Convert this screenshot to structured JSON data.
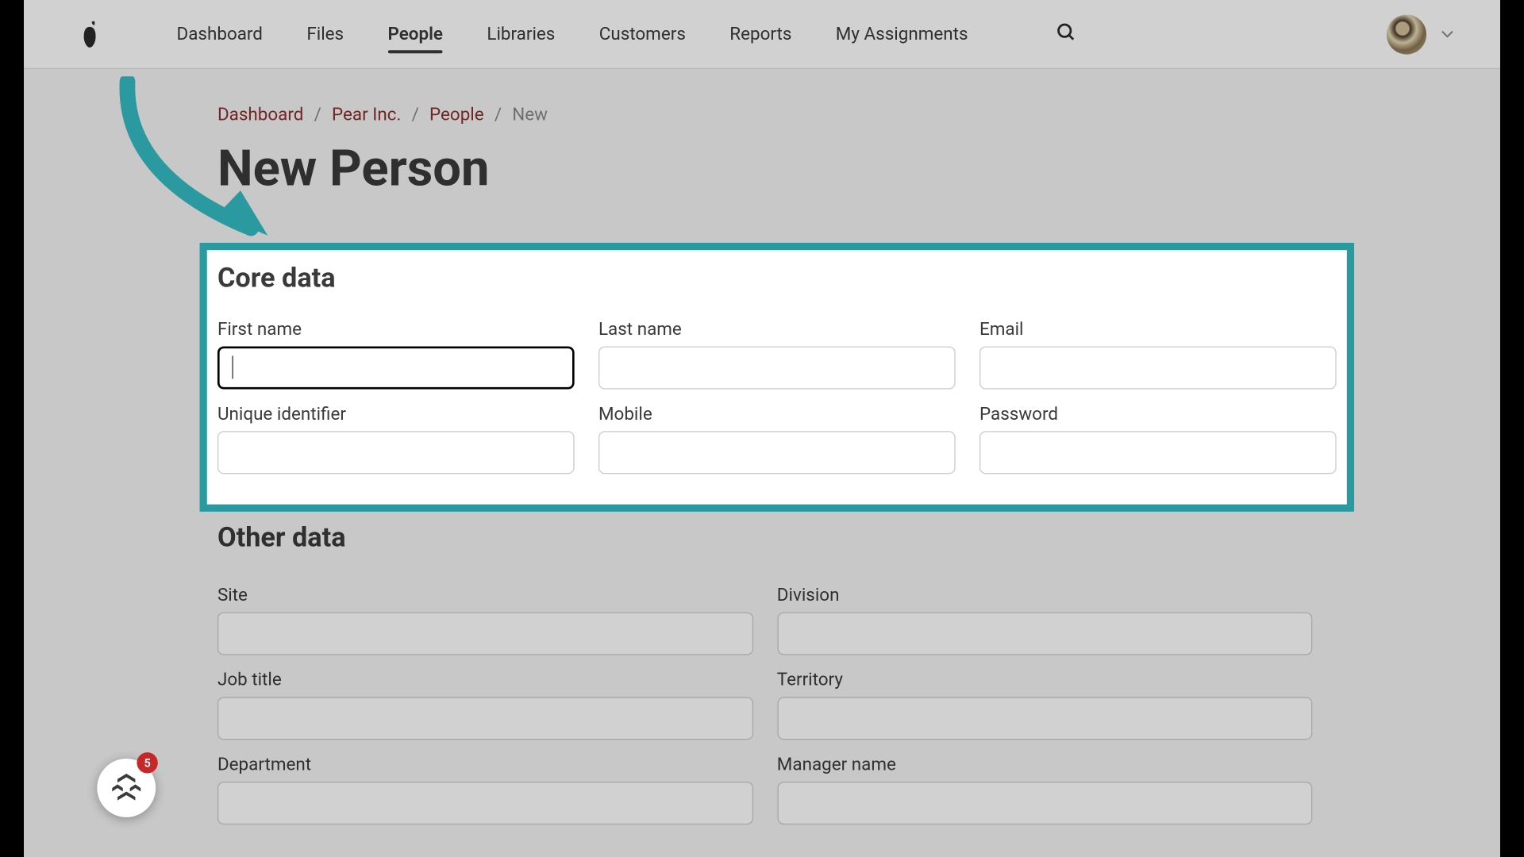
{
  "nav": {
    "items": [
      "Dashboard",
      "Files",
      "People",
      "Libraries",
      "Customers",
      "Reports",
      "My Assignments"
    ],
    "active_index": 2
  },
  "breadcrumb": {
    "items": [
      "Dashboard",
      "Pear Inc.",
      "People"
    ],
    "current": "New"
  },
  "page": {
    "title": "New Person"
  },
  "sections": {
    "core": {
      "title": "Core data",
      "fields": [
        {
          "label": "First name",
          "value": ""
        },
        {
          "label": "Last name",
          "value": ""
        },
        {
          "label": "Email",
          "value": ""
        },
        {
          "label": "Unique identifier",
          "value": ""
        },
        {
          "label": "Mobile",
          "value": ""
        },
        {
          "label": "Password",
          "value": ""
        }
      ]
    },
    "other": {
      "title": "Other data",
      "fields": [
        {
          "label": "Site",
          "value": ""
        },
        {
          "label": "Division",
          "value": ""
        },
        {
          "label": "Job title",
          "value": ""
        },
        {
          "label": "Territory",
          "value": ""
        },
        {
          "label": "Department",
          "value": ""
        },
        {
          "label": "Manager name",
          "value": ""
        }
      ]
    }
  },
  "help": {
    "badge_count": "5"
  },
  "colors": {
    "highlight": "#2a9aa0",
    "link": "#8a2e2e"
  }
}
